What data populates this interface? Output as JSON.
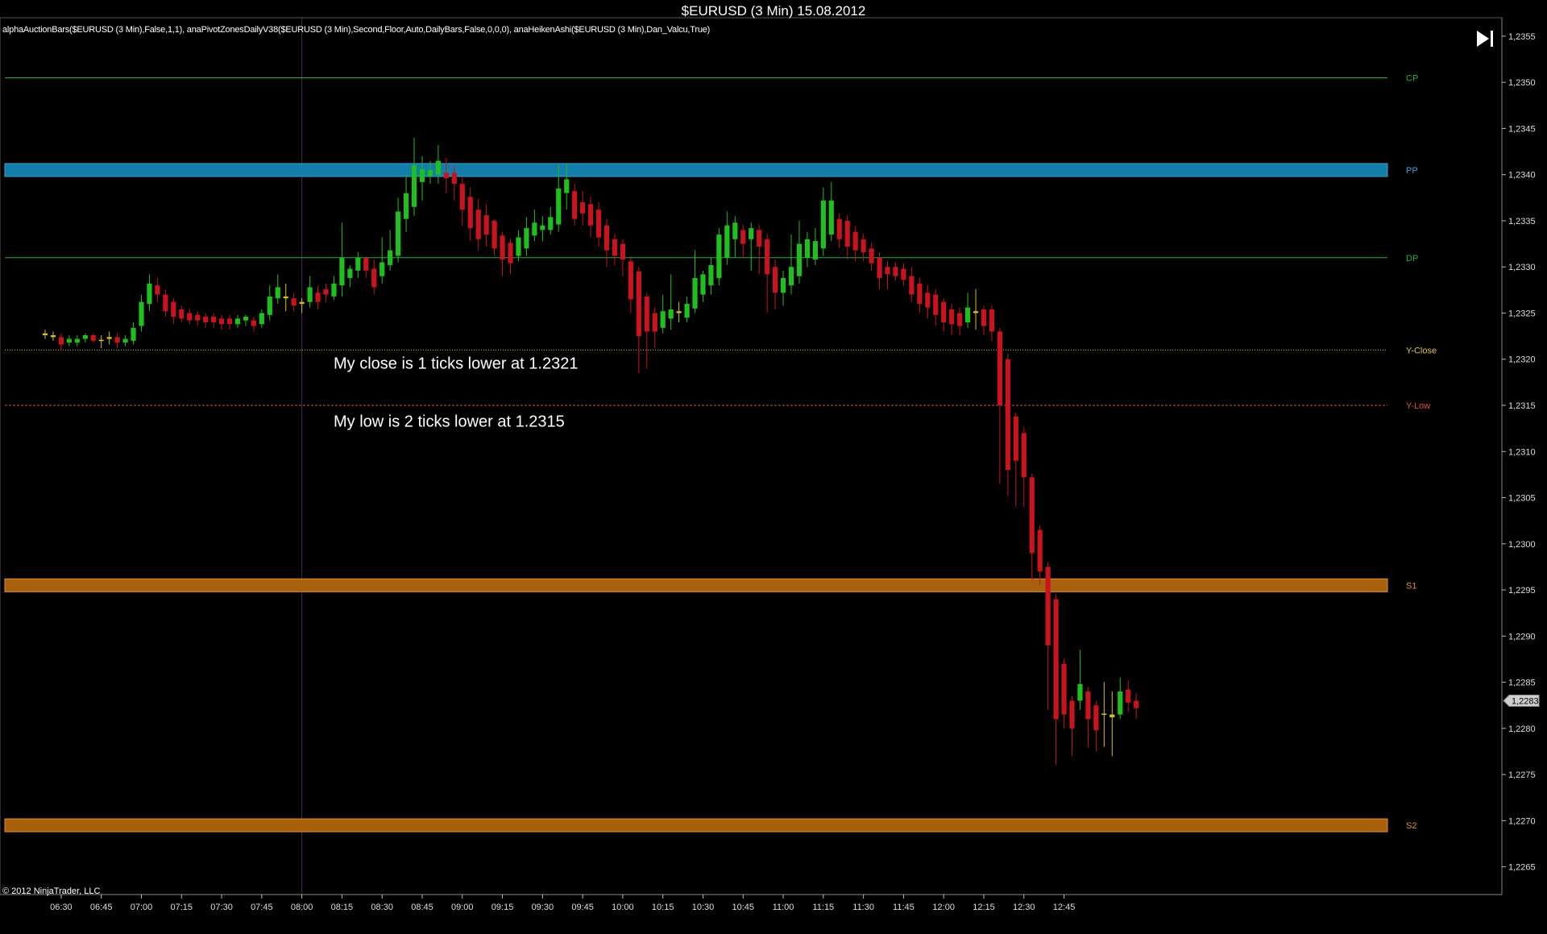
{
  "window": {
    "title": "$EURUSD (3 Min)  15.08.2012",
    "indicators": "alphaAuctionBars($EURUSD (3 Min),False,1,1), anaPivotZonesDailyV38($EURUSD (3 Min),Second,Floor,Auto,DailyBars,False,0,0,0), anaHeikenAshi($EURUSD (3 Min),Dan_Valcu,True)",
    "copyright": "© 2012 NinjaTrader, LLC",
    "end_icon": "skip-to-end-icon"
  },
  "chart_data": {
    "type": "candlestick",
    "instrument": "$EURUSD",
    "interval": "3 Min",
    "date": "15.08.2012",
    "ylim": [
      1.2262,
      1.2357
    ],
    "xlim": [
      "06:24",
      "13:24"
    ],
    "y_ticks": [
      "1,2265",
      "1,2270",
      "1,2275",
      "1,2280",
      "1,2285",
      "1,2290",
      "1,2295",
      "1,2300",
      "1,2305",
      "1,2310",
      "1,2315",
      "1,2320",
      "1,2325",
      "1,2330",
      "1,2335",
      "1,2340",
      "1,2345",
      "1,2350",
      "1,2355"
    ],
    "x_ticks": [
      "06:30",
      "06:45",
      "07:00",
      "07:15",
      "07:30",
      "07:45",
      "08:00",
      "08:15",
      "08:30",
      "08:45",
      "09:00",
      "09:15",
      "09:30",
      "09:45",
      "10:00",
      "10:15",
      "10:30",
      "10:45",
      "11:00",
      "11:15",
      "11:30",
      "11:45",
      "12:00",
      "12:15",
      "12:30",
      "12:45"
    ],
    "last_price": "1,2283",
    "session_marker": "08:00",
    "colors": {
      "up": "#1fbf1f",
      "down": "#c8141e",
      "doji": "#d8c020",
      "grid": "#333333"
    },
    "levels": [
      {
        "name": "CP",
        "value": 1.23505,
        "color": "#21b04a",
        "style": "solid"
      },
      {
        "name": "PP",
        "value": 1.23405,
        "color": "#3aa0e0",
        "style": "band",
        "fill": "#137ea8",
        "band": [
          1.23398,
          1.23412
        ]
      },
      {
        "name": "DP",
        "value": 1.2331,
        "color": "#21b04a",
        "style": "solid"
      },
      {
        "name": "Y-Close",
        "value": 1.2321,
        "color": "#e0c040",
        "style": "dotted"
      },
      {
        "name": "Y-Low",
        "value": 1.2315,
        "color": "#e05030",
        "style": "dashed"
      },
      {
        "name": "S1",
        "value": 1.22955,
        "color": "#e09030",
        "style": "band",
        "fill": "#a8600c",
        "band": [
          1.22948,
          1.22962
        ]
      },
      {
        "name": "S2",
        "value": 1.22695,
        "color": "#e09030",
        "style": "band",
        "fill": "#a8600c",
        "band": [
          1.22688,
          1.22702
        ]
      }
    ],
    "annotations": [
      {
        "text": "My close is 1 ticks lower at 1.2321",
        "time": "08:45",
        "price": 1.23195
      },
      {
        "text": "My low is 2 ticks lower at 1.2315",
        "time": "08:45",
        "price": 1.23132
      }
    ],
    "candles": [
      {
        "t": "06:24",
        "o": 1.23228,
        "h": 1.23232,
        "l": 1.23222,
        "c": 1.23226
      },
      {
        "t": "06:27",
        "o": 1.23226,
        "h": 1.2323,
        "l": 1.2322,
        "c": 1.23224
      },
      {
        "t": "06:30",
        "o": 1.23224,
        "h": 1.23228,
        "l": 1.2321,
        "c": 1.23216
      },
      {
        "t": "06:33",
        "o": 1.23218,
        "h": 1.23226,
        "l": 1.23214,
        "c": 1.23222
      },
      {
        "t": "06:36",
        "o": 1.23218,
        "h": 1.23226,
        "l": 1.23214,
        "c": 1.23222
      },
      {
        "t": "06:39",
        "o": 1.23222,
        "h": 1.23228,
        "l": 1.23218,
        "c": 1.23226
      },
      {
        "t": "06:42",
        "o": 1.23226,
        "h": 1.23228,
        "l": 1.23218,
        "c": 1.2322
      },
      {
        "t": "06:45",
        "o": 1.2322,
        "h": 1.23226,
        "l": 1.23212,
        "c": 1.23221
      },
      {
        "t": "06:48",
        "o": 1.23222,
        "h": 1.2323,
        "l": 1.23216,
        "c": 1.23224
      },
      {
        "t": "06:51",
        "o": 1.23224,
        "h": 1.23228,
        "l": 1.23212,
        "c": 1.23218
      },
      {
        "t": "06:54",
        "o": 1.23218,
        "h": 1.23226,
        "l": 1.23214,
        "c": 1.23222
      },
      {
        "t": "06:57",
        "o": 1.2322,
        "h": 1.2324,
        "l": 1.23216,
        "c": 1.23234
      },
      {
        "t": "07:00",
        "o": 1.23236,
        "h": 1.2327,
        "l": 1.2323,
        "c": 1.23262
      },
      {
        "t": "07:03",
        "o": 1.2326,
        "h": 1.23292,
        "l": 1.23252,
        "c": 1.23282
      },
      {
        "t": "07:06",
        "o": 1.2328,
        "h": 1.23288,
        "l": 1.23262,
        "c": 1.2327
      },
      {
        "t": "07:09",
        "o": 1.2327,
        "h": 1.23275,
        "l": 1.23246,
        "c": 1.23252
      },
      {
        "t": "07:12",
        "o": 1.23262,
        "h": 1.23266,
        "l": 1.23238,
        "c": 1.23246
      },
      {
        "t": "07:15",
        "o": 1.23254,
        "h": 1.23258,
        "l": 1.2324,
        "c": 1.23244
      },
      {
        "t": "07:18",
        "o": 1.2325,
        "h": 1.23255,
        "l": 1.23238,
        "c": 1.23242
      },
      {
        "t": "07:21",
        "o": 1.23248,
        "h": 1.23252,
        "l": 1.23236,
        "c": 1.23242
      },
      {
        "t": "07:24",
        "o": 1.23246,
        "h": 1.2325,
        "l": 1.23234,
        "c": 1.2324
      },
      {
        "t": "07:27",
        "o": 1.23246,
        "h": 1.2325,
        "l": 1.23234,
        "c": 1.2324
      },
      {
        "t": "07:30",
        "o": 1.23244,
        "h": 1.23248,
        "l": 1.23232,
        "c": 1.23238
      },
      {
        "t": "07:33",
        "o": 1.23244,
        "h": 1.23248,
        "l": 1.23232,
        "c": 1.23238
      },
      {
        "t": "07:36",
        "o": 1.23238,
        "h": 1.23248,
        "l": 1.23234,
        "c": 1.23244
      },
      {
        "t": "07:39",
        "o": 1.23242,
        "h": 1.23248,
        "l": 1.23236,
        "c": 1.23246
      },
      {
        "t": "07:42",
        "o": 1.23242,
        "h": 1.23246,
        "l": 1.2323,
        "c": 1.23236
      },
      {
        "t": "07:45",
        "o": 1.23238,
        "h": 1.23254,
        "l": 1.23234,
        "c": 1.2325
      },
      {
        "t": "07:48",
        "o": 1.23248,
        "h": 1.2328,
        "l": 1.23242,
        "c": 1.23268
      },
      {
        "t": "07:51",
        "o": 1.23266,
        "h": 1.23292,
        "l": 1.2326,
        "c": 1.23278
      },
      {
        "t": "07:54",
        "o": 1.23268,
        "h": 1.23282,
        "l": 1.23252,
        "c": 1.23266
      },
      {
        "t": "07:57",
        "o": 1.23266,
        "h": 1.23272,
        "l": 1.23252,
        "c": 1.23258
      },
      {
        "t": "08:00",
        "o": 1.2326,
        "h": 1.23266,
        "l": 1.2325,
        "c": 1.23262
      },
      {
        "t": "08:03",
        "o": 1.23262,
        "h": 1.2329,
        "l": 1.23256,
        "c": 1.23278
      },
      {
        "t": "08:06",
        "o": 1.23272,
        "h": 1.2328,
        "l": 1.23254,
        "c": 1.23262
      },
      {
        "t": "08:09",
        "o": 1.23276,
        "h": 1.23282,
        "l": 1.23262,
        "c": 1.2327
      },
      {
        "t": "08:12",
        "o": 1.23268,
        "h": 1.2329,
        "l": 1.23264,
        "c": 1.23282
      },
      {
        "t": "08:15",
        "o": 1.2328,
        "h": 1.23348,
        "l": 1.23268,
        "c": 1.2331
      },
      {
        "t": "08:18",
        "o": 1.23288,
        "h": 1.23302,
        "l": 1.23278,
        "c": 1.23298
      },
      {
        "t": "08:21",
        "o": 1.23296,
        "h": 1.23316,
        "l": 1.23288,
        "c": 1.2331
      },
      {
        "t": "08:24",
        "o": 1.2331,
        "h": 1.23312,
        "l": 1.23288,
        "c": 1.23296
      },
      {
        "t": "08:27",
        "o": 1.23298,
        "h": 1.23308,
        "l": 1.2327,
        "c": 1.23278
      },
      {
        "t": "08:30",
        "o": 1.2329,
        "h": 1.23332,
        "l": 1.23282,
        "c": 1.23305
      },
      {
        "t": "08:33",
        "o": 1.23302,
        "h": 1.2334,
        "l": 1.23296,
        "c": 1.23318
      },
      {
        "t": "08:36",
        "o": 1.23312,
        "h": 1.23375,
        "l": 1.23305,
        "c": 1.2336
      },
      {
        "t": "08:39",
        "o": 1.23352,
        "h": 1.234,
        "l": 1.23338,
        "c": 1.2338
      },
      {
        "t": "08:42",
        "o": 1.23365,
        "h": 1.2344,
        "l": 1.23355,
        "c": 1.2341
      },
      {
        "t": "08:45",
        "o": 1.23392,
        "h": 1.2342,
        "l": 1.23372,
        "c": 1.23406
      },
      {
        "t": "08:48",
        "o": 1.23398,
        "h": 1.23415,
        "l": 1.2339,
        "c": 1.23405
      },
      {
        "t": "08:51",
        "o": 1.234,
        "h": 1.23432,
        "l": 1.2339,
        "c": 1.23415
      },
      {
        "t": "08:54",
        "o": 1.23402,
        "h": 1.23418,
        "l": 1.2338,
        "c": 1.23396
      },
      {
        "t": "08:57",
        "o": 1.23402,
        "h": 1.2341,
        "l": 1.23372,
        "c": 1.2339
      },
      {
        "t": "09:00",
        "o": 1.2339,
        "h": 1.23398,
        "l": 1.23345,
        "c": 1.23362
      },
      {
        "t": "09:03",
        "o": 1.23376,
        "h": 1.23386,
        "l": 1.23328,
        "c": 1.23342
      },
      {
        "t": "09:06",
        "o": 1.23362,
        "h": 1.23374,
        "l": 1.23318,
        "c": 1.2333
      },
      {
        "t": "09:09",
        "o": 1.23356,
        "h": 1.23368,
        "l": 1.23322,
        "c": 1.23335
      },
      {
        "t": "09:12",
        "o": 1.2335,
        "h": 1.23352,
        "l": 1.23312,
        "c": 1.2332
      },
      {
        "t": "09:15",
        "o": 1.23334,
        "h": 1.23338,
        "l": 1.2329,
        "c": 1.23308
      },
      {
        "t": "09:18",
        "o": 1.23326,
        "h": 1.2333,
        "l": 1.23292,
        "c": 1.23304
      },
      {
        "t": "09:21",
        "o": 1.23312,
        "h": 1.2334,
        "l": 1.23306,
        "c": 1.23332
      },
      {
        "t": "09:24",
        "o": 1.2332,
        "h": 1.23354,
        "l": 1.23312,
        "c": 1.23342
      },
      {
        "t": "09:27",
        "o": 1.23334,
        "h": 1.23362,
        "l": 1.23328,
        "c": 1.23348
      },
      {
        "t": "09:30",
        "o": 1.2334,
        "h": 1.23355,
        "l": 1.23328,
        "c": 1.23345
      },
      {
        "t": "09:33",
        "o": 1.2334,
        "h": 1.23365,
        "l": 1.23335,
        "c": 1.23354
      },
      {
        "t": "09:36",
        "o": 1.23346,
        "h": 1.2341,
        "l": 1.23338,
        "c": 1.23385
      },
      {
        "t": "09:39",
        "o": 1.2338,
        "h": 1.23412,
        "l": 1.23362,
        "c": 1.23395
      },
      {
        "t": "09:42",
        "o": 1.23382,
        "h": 1.2339,
        "l": 1.23345,
        "c": 1.23352
      },
      {
        "t": "09:45",
        "o": 1.2337,
        "h": 1.23382,
        "l": 1.23345,
        "c": 1.23358
      },
      {
        "t": "09:48",
        "o": 1.23368,
        "h": 1.23376,
        "l": 1.23332,
        "c": 1.23345
      },
      {
        "t": "09:51",
        "o": 1.23362,
        "h": 1.2337,
        "l": 1.23322,
        "c": 1.23332
      },
      {
        "t": "09:54",
        "o": 1.23345,
        "h": 1.23352,
        "l": 1.233,
        "c": 1.23318
      },
      {
        "t": "09:57",
        "o": 1.2333,
        "h": 1.23336,
        "l": 1.23302,
        "c": 1.23312
      },
      {
        "t": "10:00",
        "o": 1.23325,
        "h": 1.2333,
        "l": 1.2329,
        "c": 1.23308
      },
      {
        "t": "10:03",
        "o": 1.23306,
        "h": 1.23312,
        "l": 1.2325,
        "c": 1.23265
      },
      {
        "t": "10:06",
        "o": 1.23295,
        "h": 1.233,
        "l": 1.23185,
        "c": 1.23225
      },
      {
        "t": "10:09",
        "o": 1.23268,
        "h": 1.23272,
        "l": 1.2319,
        "c": 1.2323
      },
      {
        "t": "10:12",
        "o": 1.2325,
        "h": 1.23256,
        "l": 1.23212,
        "c": 1.2323
      },
      {
        "t": "10:15",
        "o": 1.23234,
        "h": 1.2327,
        "l": 1.23228,
        "c": 1.23252
      },
      {
        "t": "10:18",
        "o": 1.23244,
        "h": 1.23292,
        "l": 1.23232,
        "c": 1.23254
      },
      {
        "t": "10:21",
        "o": 1.23252,
        "h": 1.23262,
        "l": 1.2324,
        "c": 1.2325
      },
      {
        "t": "10:24",
        "o": 1.23245,
        "h": 1.23268,
        "l": 1.2324,
        "c": 1.2326
      },
      {
        "t": "10:27",
        "o": 1.23255,
        "h": 1.23318,
        "l": 1.2325,
        "c": 1.23288
      },
      {
        "t": "10:30",
        "o": 1.2327,
        "h": 1.23296,
        "l": 1.23262,
        "c": 1.23292
      },
      {
        "t": "10:33",
        "o": 1.2328,
        "h": 1.2331,
        "l": 1.2327,
        "c": 1.23302
      },
      {
        "t": "10:36",
        "o": 1.23288,
        "h": 1.23342,
        "l": 1.2328,
        "c": 1.23335
      },
      {
        "t": "10:39",
        "o": 1.2331,
        "h": 1.2336,
        "l": 1.23302,
        "c": 1.23345
      },
      {
        "t": "10:42",
        "o": 1.2333,
        "h": 1.23355,
        "l": 1.2331,
        "c": 1.23348
      },
      {
        "t": "10:45",
        "o": 1.2334,
        "h": 1.23346,
        "l": 1.2331,
        "c": 1.23325
      },
      {
        "t": "10:48",
        "o": 1.2333,
        "h": 1.23348,
        "l": 1.23296,
        "c": 1.23342
      },
      {
        "t": "10:51",
        "o": 1.2334,
        "h": 1.23346,
        "l": 1.23292,
        "c": 1.23322
      },
      {
        "t": "10:54",
        "o": 1.2333,
        "h": 1.23336,
        "l": 1.2325,
        "c": 1.23292
      },
      {
        "t": "10:57",
        "o": 1.233,
        "h": 1.23308,
        "l": 1.23254,
        "c": 1.23272
      },
      {
        "t": "11:00",
        "o": 1.23272,
        "h": 1.23296,
        "l": 1.23258,
        "c": 1.23288
      },
      {
        "t": "11:03",
        "o": 1.2328,
        "h": 1.23335,
        "l": 1.2327,
        "c": 1.233
      },
      {
        "t": "11:06",
        "o": 1.2329,
        "h": 1.2335,
        "l": 1.23282,
        "c": 1.23325
      },
      {
        "t": "11:09",
        "o": 1.2331,
        "h": 1.23338,
        "l": 1.233,
        "c": 1.2333
      },
      {
        "t": "11:12",
        "o": 1.23308,
        "h": 1.23342,
        "l": 1.23302,
        "c": 1.23328
      },
      {
        "t": "11:15",
        "o": 1.2332,
        "h": 1.23386,
        "l": 1.23312,
        "c": 1.23372
      },
      {
        "t": "11:18",
        "o": 1.23335,
        "h": 1.23392,
        "l": 1.23328,
        "c": 1.23372
      },
      {
        "t": "11:21",
        "o": 1.23352,
        "h": 1.23358,
        "l": 1.2332,
        "c": 1.2333
      },
      {
        "t": "11:24",
        "o": 1.2335,
        "h": 1.23356,
        "l": 1.23308,
        "c": 1.23322
      },
      {
        "t": "11:27",
        "o": 1.23338,
        "h": 1.23344,
        "l": 1.23306,
        "c": 1.23318
      },
      {
        "t": "11:30",
        "o": 1.2333,
        "h": 1.23336,
        "l": 1.23306,
        "c": 1.23316
      },
      {
        "t": "11:33",
        "o": 1.2332,
        "h": 1.23326,
        "l": 1.23296,
        "c": 1.23304
      },
      {
        "t": "11:36",
        "o": 1.2331,
        "h": 1.23316,
        "l": 1.23276,
        "c": 1.23288
      },
      {
        "t": "11:39",
        "o": 1.233,
        "h": 1.23306,
        "l": 1.23276,
        "c": 1.23292
      },
      {
        "t": "11:42",
        "o": 1.233,
        "h": 1.23305,
        "l": 1.23285,
        "c": 1.2329
      },
      {
        "t": "11:45",
        "o": 1.23298,
        "h": 1.23304,
        "l": 1.2328,
        "c": 1.23286
      },
      {
        "t": "11:48",
        "o": 1.2329,
        "h": 1.233,
        "l": 1.23262,
        "c": 1.2327
      },
      {
        "t": "11:51",
        "o": 1.23282,
        "h": 1.23288,
        "l": 1.2325,
        "c": 1.2326
      },
      {
        "t": "11:54",
        "o": 1.23272,
        "h": 1.2328,
        "l": 1.23244,
        "c": 1.23256
      },
      {
        "t": "11:57",
        "o": 1.2327,
        "h": 1.23276,
        "l": 1.23236,
        "c": 1.23248
      },
      {
        "t": "12:00",
        "o": 1.23262,
        "h": 1.23266,
        "l": 1.2323,
        "c": 1.2324
      },
      {
        "t": "12:03",
        "o": 1.23254,
        "h": 1.2326,
        "l": 1.23226,
        "c": 1.23238
      },
      {
        "t": "12:06",
        "o": 1.2325,
        "h": 1.23256,
        "l": 1.23226,
        "c": 1.23236
      },
      {
        "t": "12:09",
        "o": 1.2324,
        "h": 1.23272,
        "l": 1.23234,
        "c": 1.23256
      },
      {
        "t": "12:12",
        "o": 1.2325,
        "h": 1.23276,
        "l": 1.23232,
        "c": 1.23252
      },
      {
        "t": "12:15",
        "o": 1.23254,
        "h": 1.23258,
        "l": 1.23226,
        "c": 1.23236
      },
      {
        "t": "12:18",
        "o": 1.23254,
        "h": 1.23258,
        "l": 1.2322,
        "c": 1.2323
      },
      {
        "t": "12:21",
        "o": 1.2323,
        "h": 1.23234,
        "l": 1.23065,
        "c": 1.2315
      },
      {
        "t": "12:24",
        "o": 1.232,
        "h": 1.23206,
        "l": 1.23052,
        "c": 1.2308
      },
      {
        "t": "12:27",
        "o": 1.23138,
        "h": 1.23142,
        "l": 1.2304,
        "c": 1.2309
      },
      {
        "t": "12:30",
        "o": 1.2312,
        "h": 1.23126,
        "l": 1.2304,
        "c": 1.23072
      },
      {
        "t": "12:33",
        "o": 1.23072,
        "h": 1.23076,
        "l": 1.2296,
        "c": 1.2299
      },
      {
        "t": "12:36",
        "o": 1.23015,
        "h": 1.2302,
        "l": 1.22955,
        "c": 1.2297
      },
      {
        "t": "12:39",
        "o": 1.22975,
        "h": 1.2298,
        "l": 1.2282,
        "c": 1.2289
      },
      {
        "t": "12:42",
        "o": 1.2294,
        "h": 1.22945,
        "l": 1.2276,
        "c": 1.2281
      },
      {
        "t": "12:45",
        "o": 1.2287,
        "h": 1.22875,
        "l": 1.228,
        "c": 1.22815
      },
      {
        "t": "12:48",
        "o": 1.2283,
        "h": 1.22835,
        "l": 1.2277,
        "c": 1.228
      },
      {
        "t": "12:51",
        "o": 1.2283,
        "h": 1.22885,
        "l": 1.2282,
        "c": 1.22848
      },
      {
        "t": "12:54",
        "o": 1.2284,
        "h": 1.22845,
        "l": 1.2278,
        "c": 1.2281
      },
      {
        "t": "12:57",
        "o": 1.22825,
        "h": 1.2283,
        "l": 1.22775,
        "c": 1.22798
      },
      {
        "t": "13:00",
        "o": 1.22815,
        "h": 1.2285,
        "l": 1.2278,
        "c": 1.22816
      },
      {
        "t": "13:03",
        "o": 1.22815,
        "h": 1.2284,
        "l": 1.2277,
        "c": 1.22812
      },
      {
        "t": "13:06",
        "o": 1.22815,
        "h": 1.22855,
        "l": 1.2281,
        "c": 1.2284
      },
      {
        "t": "13:09",
        "o": 1.22842,
        "h": 1.22852,
        "l": 1.22818,
        "c": 1.22828
      },
      {
        "t": "13:12",
        "o": 1.2283,
        "h": 1.22838,
        "l": 1.2281,
        "c": 1.22822
      }
    ]
  }
}
